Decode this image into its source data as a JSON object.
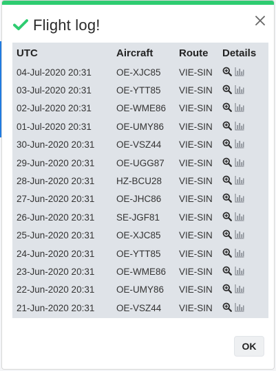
{
  "dialog": {
    "title": "Flight log!",
    "ok_label": "OK",
    "accent_color": "#2ecc71"
  },
  "table": {
    "headers": [
      "UTC",
      "Aircraft",
      "Route",
      "Details"
    ],
    "rows": [
      {
        "utc": "04-Jul-2020 20:31",
        "aircraft": "OE-XJC85",
        "route": "VIE-SIN"
      },
      {
        "utc": "03-Jul-2020 20:31",
        "aircraft": "OE-YTT85",
        "route": "VIE-SIN"
      },
      {
        "utc": "02-Jul-2020 20:31",
        "aircraft": "OE-WME86",
        "route": "VIE-SIN"
      },
      {
        "utc": "01-Jul-2020 20:31",
        "aircraft": "OE-UMY86",
        "route": "VIE-SIN"
      },
      {
        "utc": "30-Jun-2020 20:31",
        "aircraft": "OE-VSZ44",
        "route": "VIE-SIN"
      },
      {
        "utc": "29-Jun-2020 20:31",
        "aircraft": "OE-UGG87",
        "route": "VIE-SIN"
      },
      {
        "utc": "28-Jun-2020 20:31",
        "aircraft": "HZ-BCU28",
        "route": "VIE-SIN"
      },
      {
        "utc": "27-Jun-2020 20:31",
        "aircraft": "OE-JHC86",
        "route": "VIE-SIN"
      },
      {
        "utc": "26-Jun-2020 20:31",
        "aircraft": "SE-JGF81",
        "route": "VIE-SIN"
      },
      {
        "utc": "25-Jun-2020 20:31",
        "aircraft": "OE-XJC85",
        "route": "VIE-SIN"
      },
      {
        "utc": "24-Jun-2020 20:31",
        "aircraft": "OE-YTT85",
        "route": "VIE-SIN"
      },
      {
        "utc": "23-Jun-2020 20:31",
        "aircraft": "OE-WME86",
        "route": "VIE-SIN"
      },
      {
        "utc": "22-Jun-2020 20:31",
        "aircraft": "OE-UMY86",
        "route": "VIE-SIN"
      },
      {
        "utc": "21-Jun-2020 20:31",
        "aircraft": "OE-VSZ44",
        "route": "VIE-SIN"
      }
    ],
    "row_icons": [
      "zoom-in-icon",
      "bar-chart-icon"
    ]
  }
}
